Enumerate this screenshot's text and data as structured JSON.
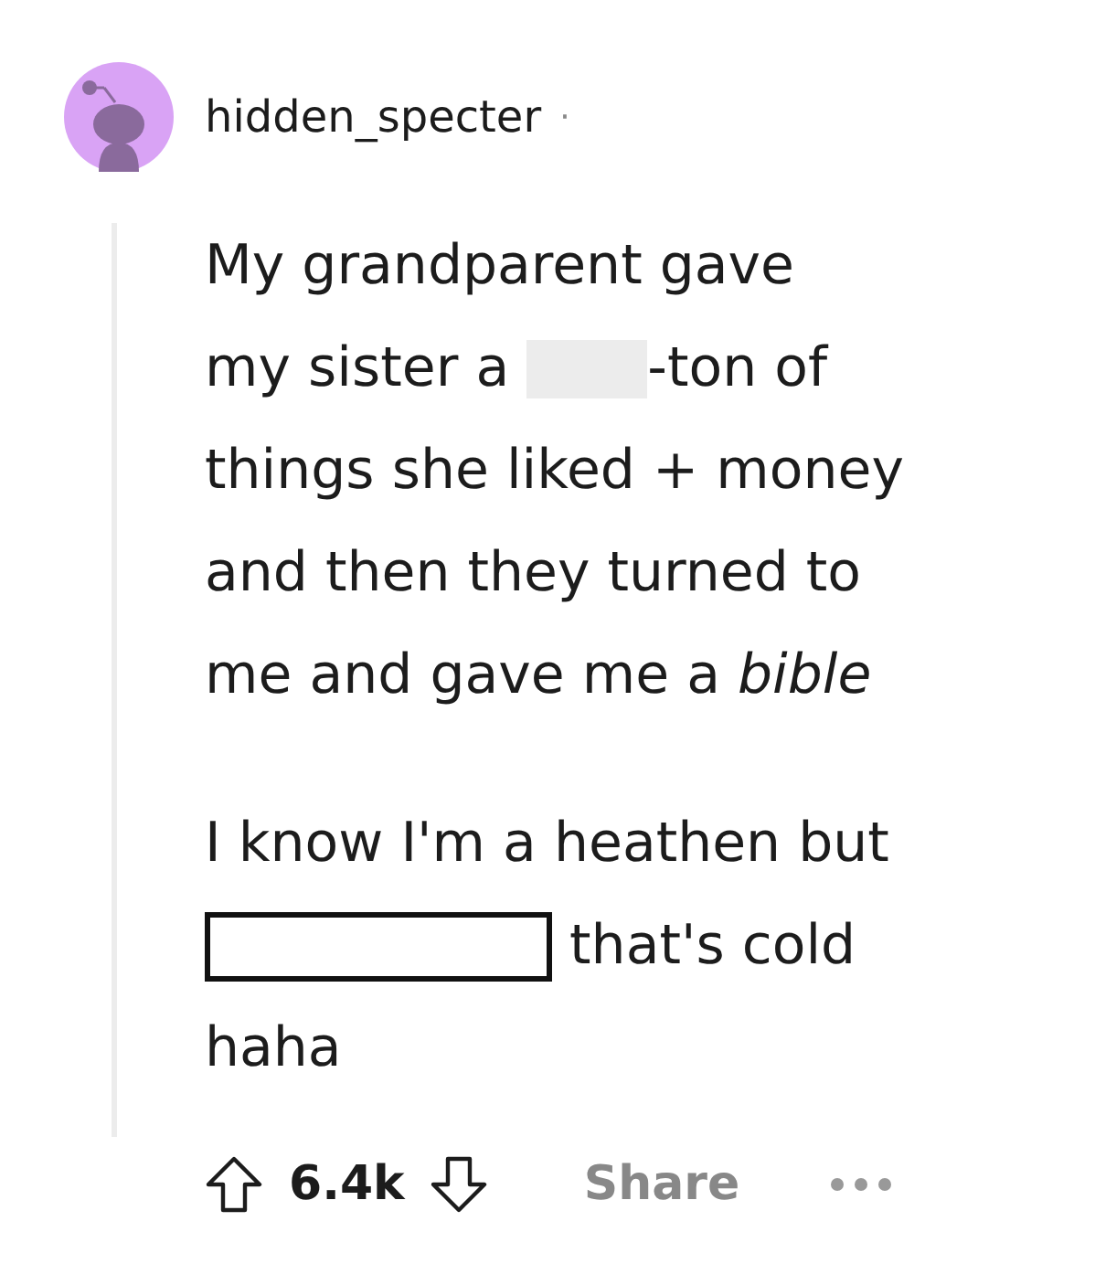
{
  "comment": {
    "author": "hidden_specter",
    "separator": "·",
    "paragraphs": [
      {
        "lines": [
          [
            {
              "kind": "text",
              "text": "My grandparent gave"
            }
          ],
          [
            {
              "kind": "text",
              "text": "my sister a "
            },
            {
              "kind": "shaded_redaction"
            },
            {
              "kind": "text",
              "text": "-ton of"
            }
          ],
          [
            {
              "kind": "text",
              "text": "things she liked + money"
            }
          ],
          [
            {
              "kind": "text",
              "text": "and then they turned to"
            }
          ],
          [
            {
              "kind": "text",
              "text": "me and gave me a *bible*"
            }
          ]
        ]
      },
      {
        "lines": [
          [
            {
              "kind": "text",
              "text": "I know I'm a heathen but"
            }
          ],
          [
            {
              "kind": "boxed_redaction"
            },
            {
              "kind": "text",
              "text": " that's cold"
            }
          ],
          [
            {
              "kind": "text",
              "text": "haha"
            }
          ]
        ]
      }
    ],
    "votes": "6.4k",
    "share": "Share"
  }
}
